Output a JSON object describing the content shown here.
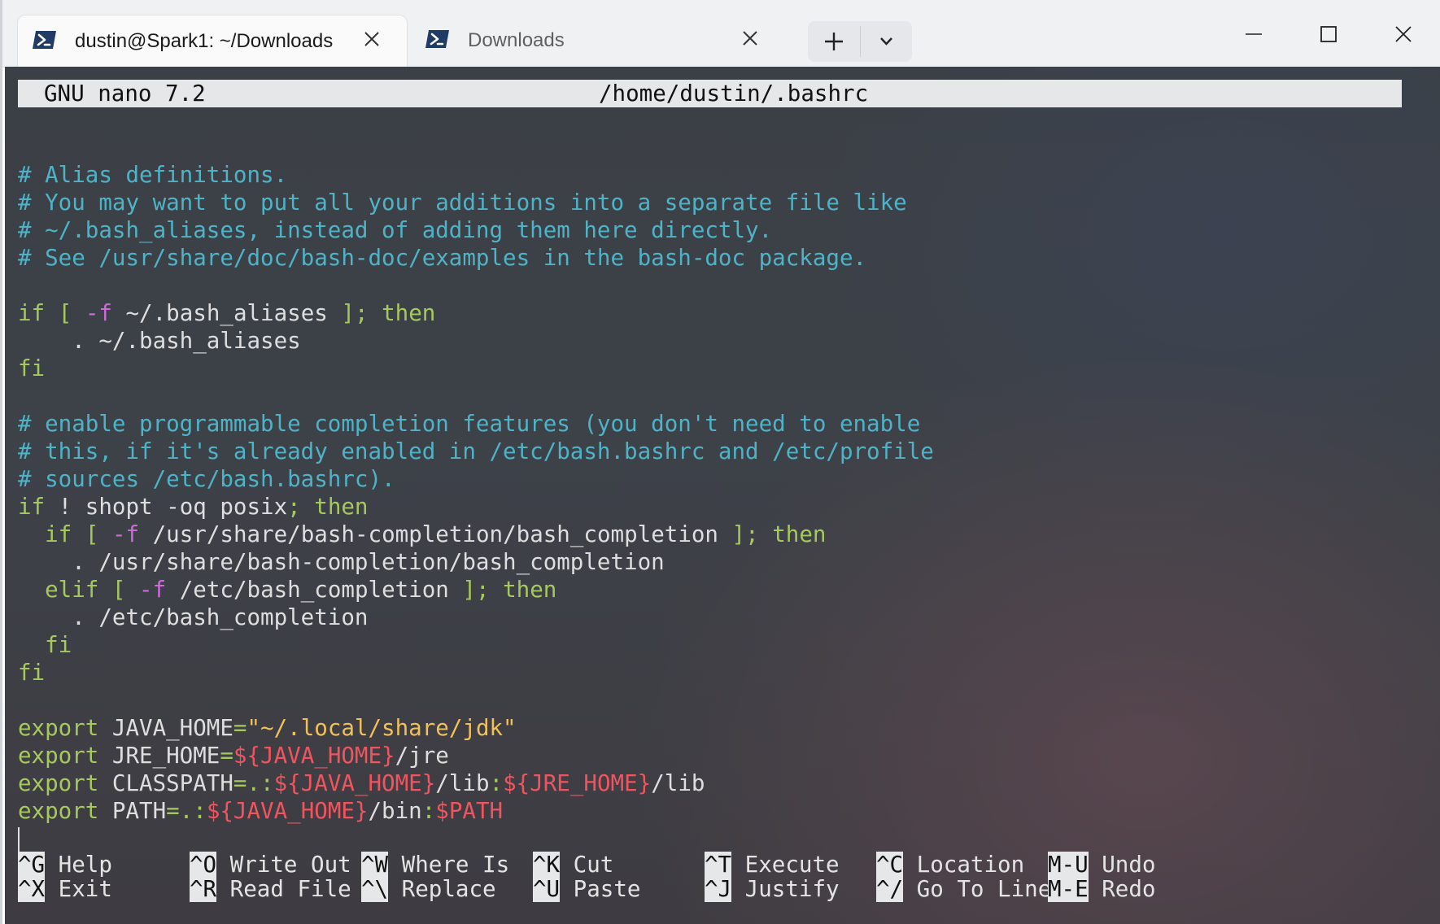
{
  "tabs": [
    {
      "title": "dustin@Spark1: ~/Downloads",
      "active": true,
      "icon": "powershell-icon"
    },
    {
      "title": "Downloads",
      "active": false,
      "icon": "powershell-icon"
    }
  ],
  "editor": {
    "version": "GNU nano 7.2",
    "file_path": "/home/dustin/.bashrc",
    "lines": [
      [],
      [
        {
          "c": "comment",
          "t": "# Alias definitions."
        }
      ],
      [
        {
          "c": "comment",
          "t": "# You may want to put all your additions into a separate file like"
        }
      ],
      [
        {
          "c": "comment",
          "t": "# ~/.bash_aliases, instead of adding them here directly."
        }
      ],
      [
        {
          "c": "comment",
          "t": "# See /usr/share/doc/bash-doc/examples in the bash-doc package."
        }
      ],
      [],
      [
        {
          "c": "kw",
          "t": "if"
        },
        {
          "c": "plain",
          "t": " "
        },
        {
          "c": "kw",
          "t": "["
        },
        {
          "c": "plain",
          "t": " "
        },
        {
          "c": "op",
          "t": "-f"
        },
        {
          "c": "plain",
          "t": " ~/.bash_aliases "
        },
        {
          "c": "kw",
          "t": "];"
        },
        {
          "c": "plain",
          "t": " "
        },
        {
          "c": "kw",
          "t": "then"
        }
      ],
      [
        {
          "c": "plain",
          "t": "    . ~/.bash_aliases"
        }
      ],
      [
        {
          "c": "kw",
          "t": "fi"
        }
      ],
      [],
      [
        {
          "c": "comment",
          "t": "# enable programmable completion features (you don't need to enable"
        }
      ],
      [
        {
          "c": "comment",
          "t": "# this, if it's already enabled in /etc/bash.bashrc and /etc/profile"
        }
      ],
      [
        {
          "c": "comment",
          "t": "# sources /etc/bash.bashrc)."
        }
      ],
      [
        {
          "c": "kw",
          "t": "if"
        },
        {
          "c": "plain",
          "t": " ! shopt -oq posix"
        },
        {
          "c": "kw",
          "t": ";"
        },
        {
          "c": "plain",
          "t": " "
        },
        {
          "c": "kw",
          "t": "then"
        }
      ],
      [
        {
          "c": "plain",
          "t": "  "
        },
        {
          "c": "kw",
          "t": "if"
        },
        {
          "c": "plain",
          "t": " "
        },
        {
          "c": "kw",
          "t": "["
        },
        {
          "c": "plain",
          "t": " "
        },
        {
          "c": "op",
          "t": "-f"
        },
        {
          "c": "plain",
          "t": " /usr/share/bash-completion/bash_completion "
        },
        {
          "c": "kw",
          "t": "];"
        },
        {
          "c": "plain",
          "t": " "
        },
        {
          "c": "kw",
          "t": "then"
        }
      ],
      [
        {
          "c": "plain",
          "t": "    . /usr/share/bash-completion/bash_completion"
        }
      ],
      [
        {
          "c": "plain",
          "t": "  "
        },
        {
          "c": "kw",
          "t": "elif"
        },
        {
          "c": "plain",
          "t": " "
        },
        {
          "c": "kw",
          "t": "["
        },
        {
          "c": "plain",
          "t": " "
        },
        {
          "c": "op",
          "t": "-f"
        },
        {
          "c": "plain",
          "t": " /etc/bash_completion "
        },
        {
          "c": "kw",
          "t": "];"
        },
        {
          "c": "plain",
          "t": " "
        },
        {
          "c": "kw",
          "t": "then"
        }
      ],
      [
        {
          "c": "plain",
          "t": "    . /etc/bash_completion"
        }
      ],
      [
        {
          "c": "plain",
          "t": "  "
        },
        {
          "c": "kw",
          "t": "fi"
        }
      ],
      [
        {
          "c": "kw",
          "t": "fi"
        }
      ],
      [],
      [
        {
          "c": "kw",
          "t": "export"
        },
        {
          "c": "plain",
          "t": " JAVA_HOME"
        },
        {
          "c": "kw",
          "t": "="
        },
        {
          "c": "str",
          "t": "\"~/.local/share/jdk\""
        }
      ],
      [
        {
          "c": "kw",
          "t": "export"
        },
        {
          "c": "plain",
          "t": " JRE_HOME"
        },
        {
          "c": "kw",
          "t": "="
        },
        {
          "c": "var",
          "t": "${JAVA_HOME}"
        },
        {
          "c": "plain",
          "t": "/jre"
        }
      ],
      [
        {
          "c": "kw",
          "t": "export"
        },
        {
          "c": "plain",
          "t": " CLASSPATH"
        },
        {
          "c": "kw",
          "t": "=.:"
        },
        {
          "c": "var",
          "t": "${JAVA_HOME}"
        },
        {
          "c": "plain",
          "t": "/lib"
        },
        {
          "c": "kw",
          "t": ":"
        },
        {
          "c": "var",
          "t": "${JRE_HOME}"
        },
        {
          "c": "plain",
          "t": "/lib"
        }
      ],
      [
        {
          "c": "kw",
          "t": "export"
        },
        {
          "c": "plain",
          "t": " PATH"
        },
        {
          "c": "kw",
          "t": "=.:"
        },
        {
          "c": "var",
          "t": "${JAVA_HOME}"
        },
        {
          "c": "plain",
          "t": "/bin"
        },
        {
          "c": "kw",
          "t": ":"
        },
        {
          "c": "var",
          "t": "$PATH"
        }
      ]
    ]
  },
  "shortcuts": [
    {
      "key": "^G",
      "label": "Help"
    },
    {
      "key": "^O",
      "label": "Write Out"
    },
    {
      "key": "^W",
      "label": "Where Is"
    },
    {
      "key": "^K",
      "label": "Cut"
    },
    {
      "key": "^T",
      "label": "Execute"
    },
    {
      "key": "^C",
      "label": "Location"
    },
    {
      "key": "M-U",
      "label": "Undo"
    },
    {
      "key": "^X",
      "label": "Exit"
    },
    {
      "key": "^R",
      "label": "Read File"
    },
    {
      "key": "^\\",
      "label": "Replace"
    },
    {
      "key": "^U",
      "label": "Paste"
    },
    {
      "key": "^J",
      "label": "Justify"
    },
    {
      "key": "^/",
      "label": "Go To Line"
    },
    {
      "key": "M-E",
      "label": "Redo"
    }
  ],
  "colors": {
    "comment": "#4fb3c8",
    "keyword": "#a6c95e",
    "flag": "#cc6bd8",
    "string": "#f0c15a",
    "variable": "#f0555f"
  }
}
